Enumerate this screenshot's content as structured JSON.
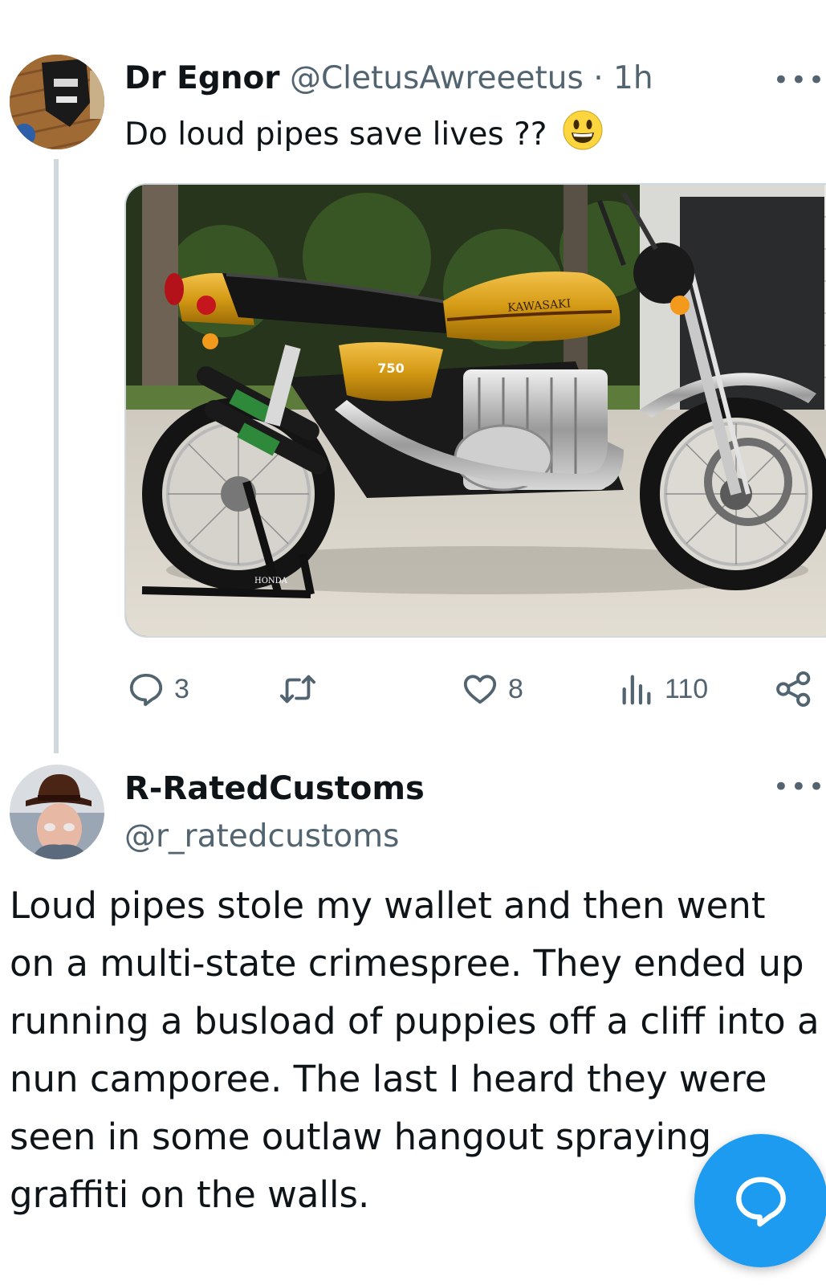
{
  "tweet": {
    "display_name": "Dr Egnor",
    "handle": "@CletusAwreeetus",
    "separator": "·",
    "time": "1h",
    "more": "•••",
    "text": "Do loud pipes save lives ??",
    "emoji_icon": "grinning-face-emoji",
    "media_alt": "Gold Kawasaki 750 motorcycle on a stand",
    "image_labels": {
      "tank_badge": "KAWASAKI",
      "side_cover": "750",
      "stand_brand": "HONDA"
    },
    "actions": {
      "replies": "3",
      "retweets": "",
      "likes": "8",
      "views": "110"
    }
  },
  "reply": {
    "display_name": "R-RatedCustoms",
    "handle": "@r_ratedcustoms",
    "more": "•••",
    "text": "Loud pipes stole my wallet and then went on a multi-state crimespree. They ended up running a busload of puppies off a cliff into a nun camporee. The last I heard they were seen in some outlaw hangout spraying graffiti on the walls."
  },
  "colors": {
    "accent": "#1d9bf0",
    "secondary_text": "#536471",
    "thread_line": "#cfd9de",
    "tank_gold": "#d9a21b"
  },
  "icons": [
    "reply-icon",
    "retweet-icon",
    "like-icon",
    "views-icon",
    "share-icon",
    "compose-reply-icon"
  ]
}
